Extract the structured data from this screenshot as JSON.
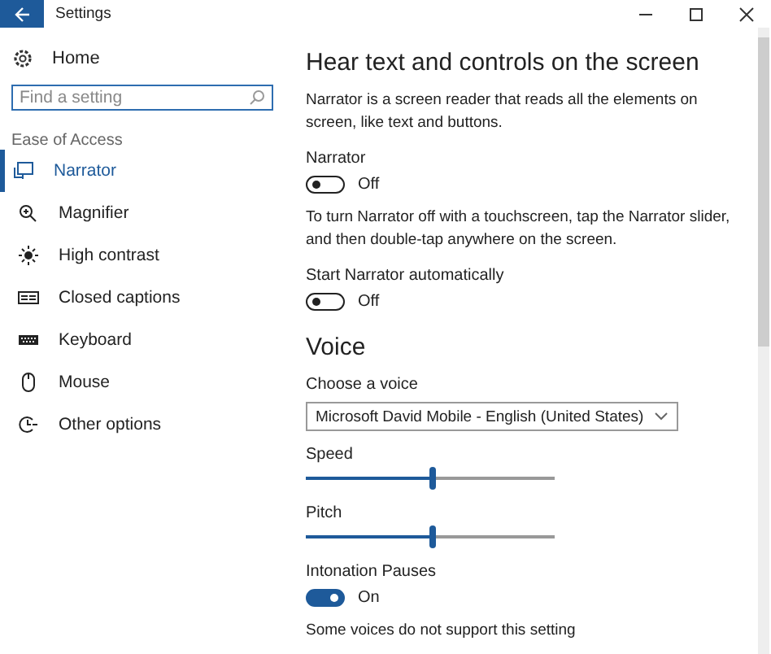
{
  "window": {
    "title": "Settings"
  },
  "sidebar": {
    "home": "Home",
    "search": {
      "placeholder": "Find a setting"
    },
    "group": "Ease of Access",
    "items": [
      {
        "label": "Narrator",
        "selected": true
      },
      {
        "label": "Magnifier",
        "selected": false
      },
      {
        "label": "High contrast",
        "selected": false
      },
      {
        "label": "Closed captions",
        "selected": false
      },
      {
        "label": "Keyboard",
        "selected": false
      },
      {
        "label": "Mouse",
        "selected": false
      },
      {
        "label": "Other options",
        "selected": false
      }
    ]
  },
  "content": [
    {
      "kind": "heading",
      "text": "Hear text and controls on the screen"
    },
    {
      "kind": "paragraph",
      "text": "Narrator is a screen reader that reads all the elements on screen, like text and buttons."
    },
    {
      "kind": "toggle",
      "label": "Narrator",
      "on": false,
      "state_text": "Off"
    },
    {
      "kind": "paragraph",
      "text": "To turn Narrator off with a touchscreen, tap the Narrator slider, and then double-tap anywhere on the screen."
    },
    {
      "kind": "toggle",
      "label": "Start Narrator automatically",
      "on": false,
      "state_text": "Off"
    },
    {
      "kind": "heading",
      "text": "Voice"
    },
    {
      "kind": "dropdown",
      "label": "Choose a voice",
      "value": "Microsoft David Mobile - English (United States)"
    },
    {
      "kind": "slider",
      "label": "Speed",
      "level": 0.51
    },
    {
      "kind": "slider",
      "label": "Pitch",
      "level": 0.51
    },
    {
      "kind": "toggle",
      "label": "Intonation Pauses",
      "on": true,
      "state_text": "On"
    },
    {
      "kind": "paragraph",
      "text": "Some voices do not support this setting"
    }
  ]
}
